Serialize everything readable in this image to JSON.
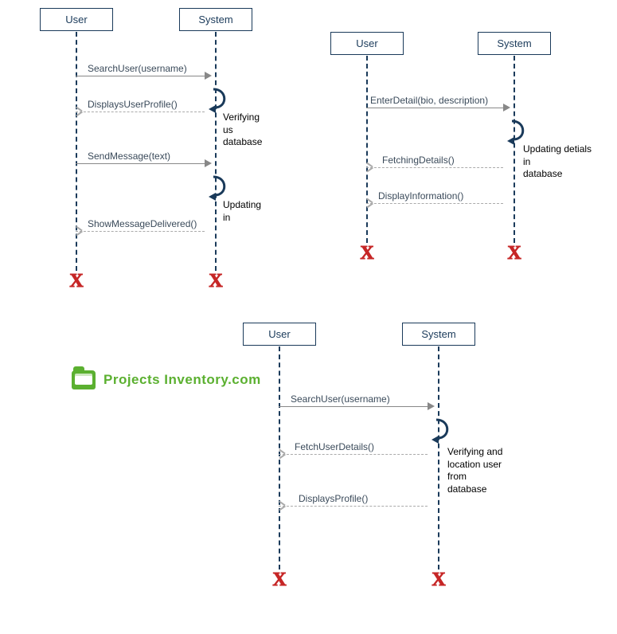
{
  "watermark": {
    "text": "Projects Inventory.com"
  },
  "diagrams": {
    "d1": {
      "user": "User",
      "system": "System",
      "m1": "SearchUser(username)",
      "m2": "DisplaysUserProfile()",
      "note1a": "Verifying us",
      "note1b": "database",
      "m3": "SendMessage(text)",
      "note2": "Updating in",
      "m4": "ShowMessageDelivered()"
    },
    "d2": {
      "user": "User",
      "system": "System",
      "m1": "EnterDetail(bio, description)",
      "note1a": "Updating detials in",
      "note1b": "database",
      "m2": "FetchingDetails()",
      "m3": "DisplayInformation()"
    },
    "d3": {
      "user": "User",
      "system": "System",
      "m1": "SearchUser(username)",
      "m2": "FetchUserDetails()",
      "note1a": "Verifying and",
      "note1b": "location user from",
      "note1c": "database",
      "m3": "DisplaysProfile()"
    }
  }
}
